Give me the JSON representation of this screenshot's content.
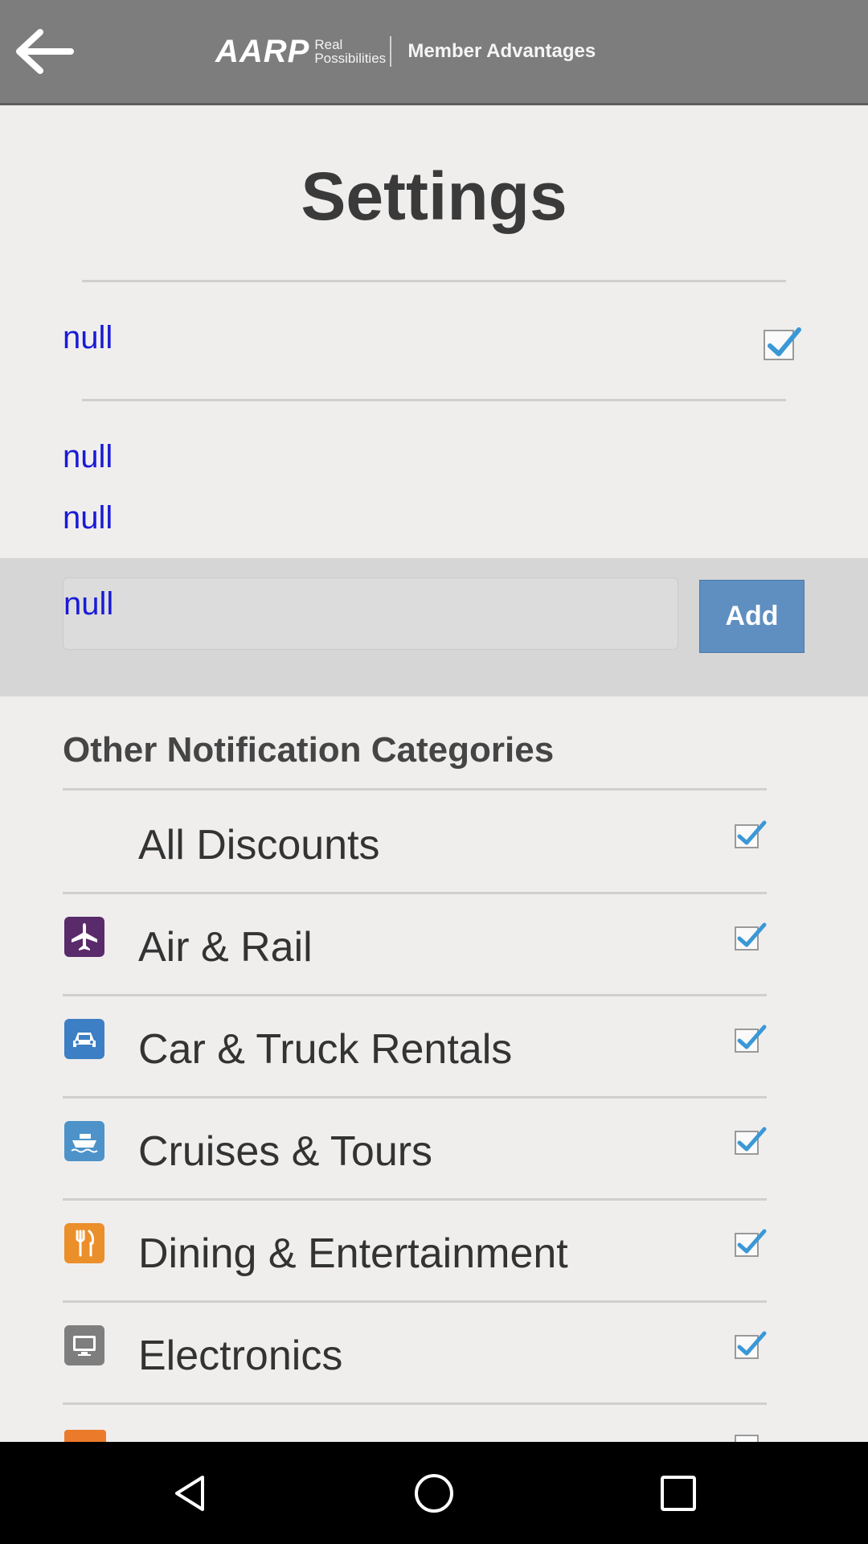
{
  "header": {
    "brand_name": "AARP",
    "brand_tagline": "Real Possibilities",
    "section_name": "Member Advantages",
    "background_color": "#7d7d7d"
  },
  "page_title": "Settings",
  "settings": {
    "first_item": {
      "label": "null",
      "checked": true
    },
    "second_item": {
      "label": "null"
    },
    "third_item": {
      "label": "null"
    }
  },
  "add_panel": {
    "input_value": "null",
    "add_button_label": "Add",
    "button_color": "#5f8fc0"
  },
  "other_categories": {
    "title": "Other Notification Categories",
    "items": [
      {
        "label": "All Discounts",
        "icon": "none",
        "checked": true
      },
      {
        "label": "Air & Rail",
        "icon": "airplane-icon",
        "icon_color": "#5a2b6b",
        "checked": true
      },
      {
        "label": "Car & Truck Rentals",
        "icon": "car-icon",
        "icon_color": "#3d7fc4",
        "checked": true
      },
      {
        "label": "Cruises & Tours",
        "icon": "ship-icon",
        "icon_color": "#4d93c9",
        "checked": true
      },
      {
        "label": "Dining & Entertainment",
        "icon": "fork-knife-icon",
        "icon_color": "#eb8f2a",
        "checked": true
      },
      {
        "label": "Electronics",
        "icon": "monitor-icon",
        "icon_color": "#7e7e7e",
        "checked": true
      }
    ]
  },
  "accent_check_color": "#3b98d6",
  "nav_bar": {
    "items": [
      "back-nav-icon",
      "home-nav-icon",
      "recents-nav-icon"
    ]
  }
}
